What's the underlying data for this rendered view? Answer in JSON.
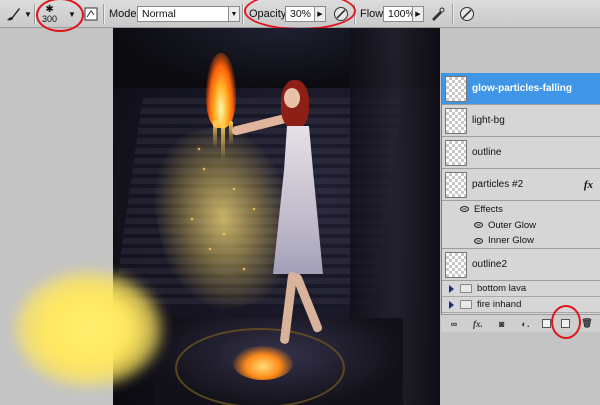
{
  "options_bar": {
    "brush_size": "300",
    "mode_label": "Mode:",
    "mode_value": "Normal",
    "opacity_label": "Opacity:",
    "opacity_value": "30%",
    "flow_label": "Flow:",
    "flow_value": "100%"
  },
  "layers": [
    {
      "name": "glow-particles-falling",
      "selected": true
    },
    {
      "name": "light-bg",
      "selected": false
    },
    {
      "name": "outline",
      "selected": false
    },
    {
      "name": "particles #2",
      "selected": false,
      "fx": "fx"
    },
    {
      "name": "outline2",
      "selected": false
    }
  ],
  "effects": {
    "label": "Effects",
    "items": [
      "Outer Glow",
      "Inner Glow"
    ]
  },
  "groups": [
    "bottom lava",
    "fire inhand"
  ],
  "bottom_bar": [
    "link-icon",
    "fx-icon",
    "mask-icon",
    "adjustment-icon",
    "group-icon",
    "new-layer-icon",
    "trash-icon"
  ],
  "colors": {
    "selection": "#3f95e6",
    "annotation": "#e0141b",
    "glow": "#ffe75e"
  }
}
